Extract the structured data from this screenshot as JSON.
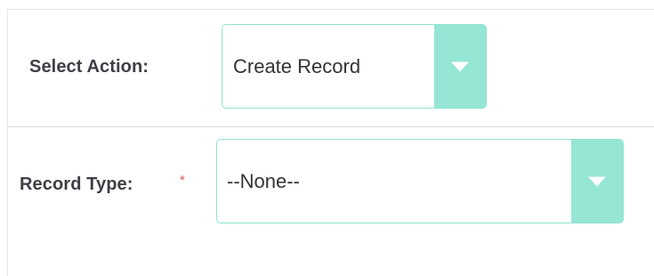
{
  "form": {
    "action_label": "Select Action:",
    "action_value": "Create Record",
    "record_type_label": "Record Type:",
    "required_marker": "*",
    "record_type_value": "--None--"
  },
  "icons": {
    "action_dropdown": "chevron-down-icon",
    "record_type_dropdown": "chevron-down-icon"
  },
  "colors": {
    "accent": "#95e6d4",
    "border": "#8fe3cf",
    "required": "#e45858",
    "label": "#3e3e47"
  }
}
